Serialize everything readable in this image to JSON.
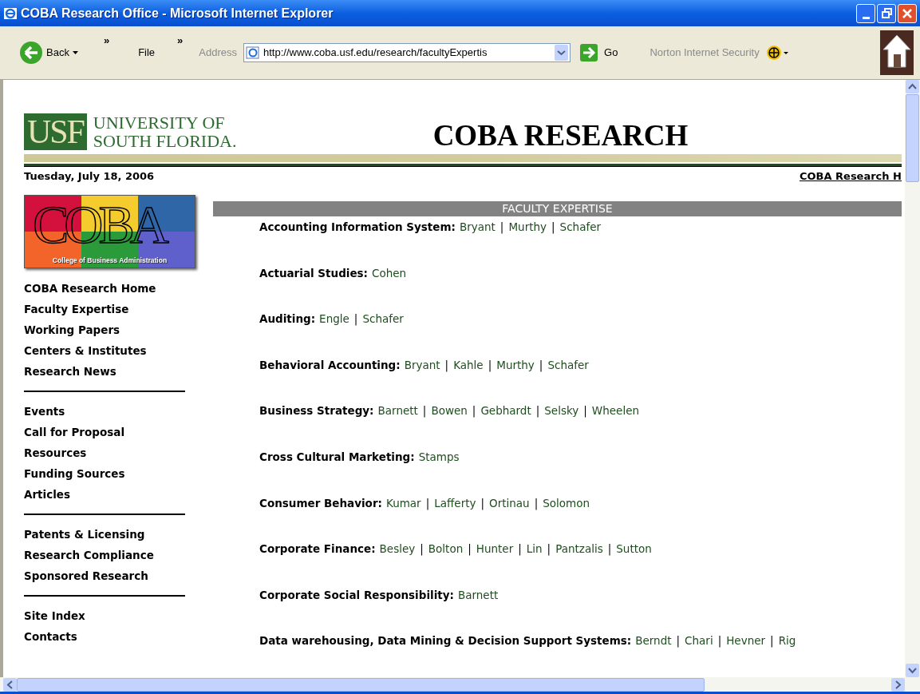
{
  "window": {
    "title": "COBA Research Office - Microsoft Internet Explorer"
  },
  "toolbar": {
    "back": "Back",
    "chevron_1": "»",
    "menu": "File",
    "chevron_2": "»",
    "address_label": "Address",
    "address": "http://www.coba.usf.edu/research/facultyExpertis",
    "go": "Go",
    "norton": "Norton Internet Security"
  },
  "header": {
    "usf_mark": "USF",
    "usf_line_1": "UNIVERSITY OF",
    "usf_line_2": "SOUTH FLORIDA.",
    "heading": "COBA RESEARCH",
    "date": "Tuesday, July 18, 2006",
    "home_link": "COBA Research H"
  },
  "coba_logo": {
    "letters": "COBA",
    "caption": "College of Business Administration"
  },
  "sidebar": {
    "groups": [
      [
        "COBA Research Home",
        "Faculty Expertise",
        "Working Papers",
        "Centers & Institutes",
        "Research News"
      ],
      [
        "Events",
        "Call for Proposal",
        "Resources",
        "Funding Sources",
        "Articles"
      ],
      [
        "Patents & Licensing",
        "Research Compliance",
        "Sponsored Research"
      ],
      [
        "Site Index",
        "Contacts"
      ]
    ]
  },
  "section_title": "FACULTY EXPERTISE",
  "name_separator": "|",
  "expertise": [
    {
      "topic": "Accounting Information System:",
      "faculty": [
        "Bryant",
        "Murthy",
        "Schafer"
      ]
    },
    {
      "topic": "Actuarial Studies:",
      "faculty": [
        "Cohen"
      ]
    },
    {
      "topic": "Auditing:",
      "faculty": [
        "Engle",
        "Schafer"
      ]
    },
    {
      "topic": "Behavioral Accounting:",
      "faculty": [
        "Bryant",
        "Kahle",
        "Murthy",
        "Schafer"
      ]
    },
    {
      "topic": "Business Strategy:",
      "faculty": [
        "Barnett",
        "Bowen",
        "Gebhardt",
        "Selsky",
        "Wheelen"
      ]
    },
    {
      "topic": "Cross Cultural Marketing:",
      "faculty": [
        "Stamps"
      ]
    },
    {
      "topic": "Consumer Behavior:",
      "faculty": [
        "Kumar",
        "Lafferty",
        "Ortinau",
        "Solomon"
      ]
    },
    {
      "topic": "Corporate Finance:",
      "faculty": [
        "Besley",
        "Bolton",
        "Hunter",
        "Lin",
        "Pantzalis",
        "Sutton"
      ]
    },
    {
      "topic": "Corporate Social Responsibility:",
      "faculty": [
        "Barnett"
      ]
    },
    {
      "topic": "Data warehousing, Data Mining & Decision Support Systems:",
      "faculty": [
        "Berndt",
        "Chari",
        "Hevner",
        "Rig"
      ]
    }
  ]
}
